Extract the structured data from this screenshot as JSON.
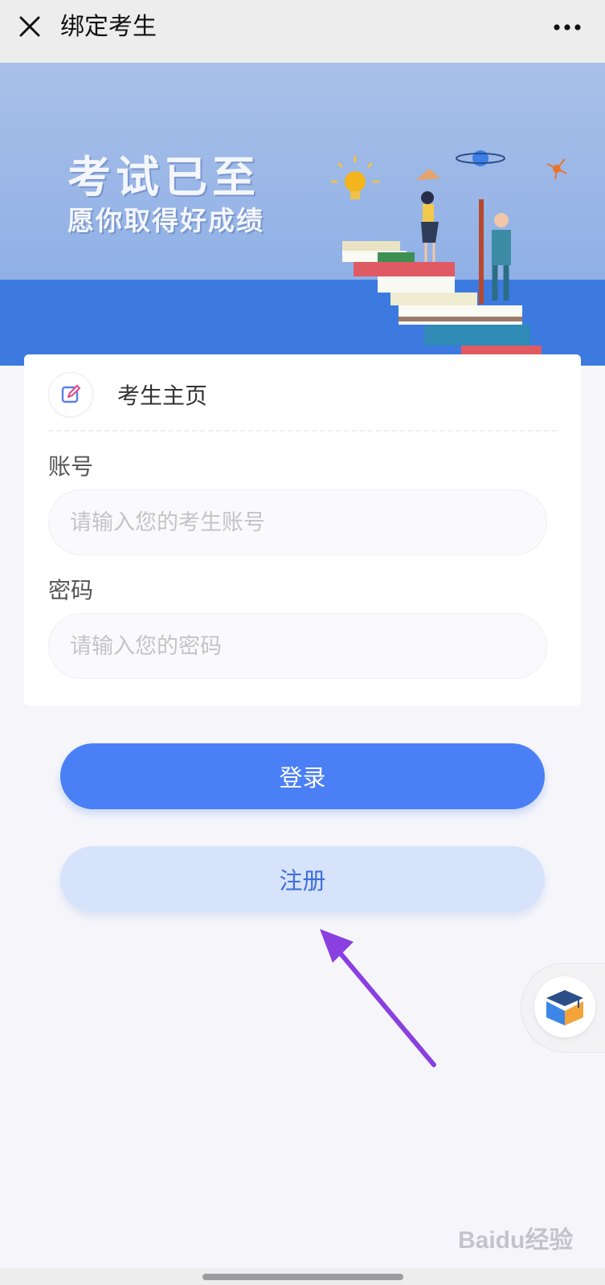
{
  "header": {
    "title": "绑定考生"
  },
  "banner": {
    "title": "考试已至",
    "subtitle": "愿你取得好成绩"
  },
  "card": {
    "title": "考生主页",
    "account": {
      "label": "账号",
      "placeholder": "请输入您的考生账号",
      "value": ""
    },
    "password": {
      "label": "密码",
      "placeholder": "请输入您的密码",
      "value": ""
    }
  },
  "buttons": {
    "login": "登录",
    "register": "注册"
  },
  "watermark": "Baidu经验",
  "colors": {
    "accent": "#4a7ff5",
    "register_bg": "#d6e3fb",
    "annotation_arrow": "#8a3fe0"
  },
  "icons": {
    "close": "close-icon",
    "more": "more-dots-icon",
    "edit": "edit-icon",
    "help": "graduation-book-icon"
  }
}
